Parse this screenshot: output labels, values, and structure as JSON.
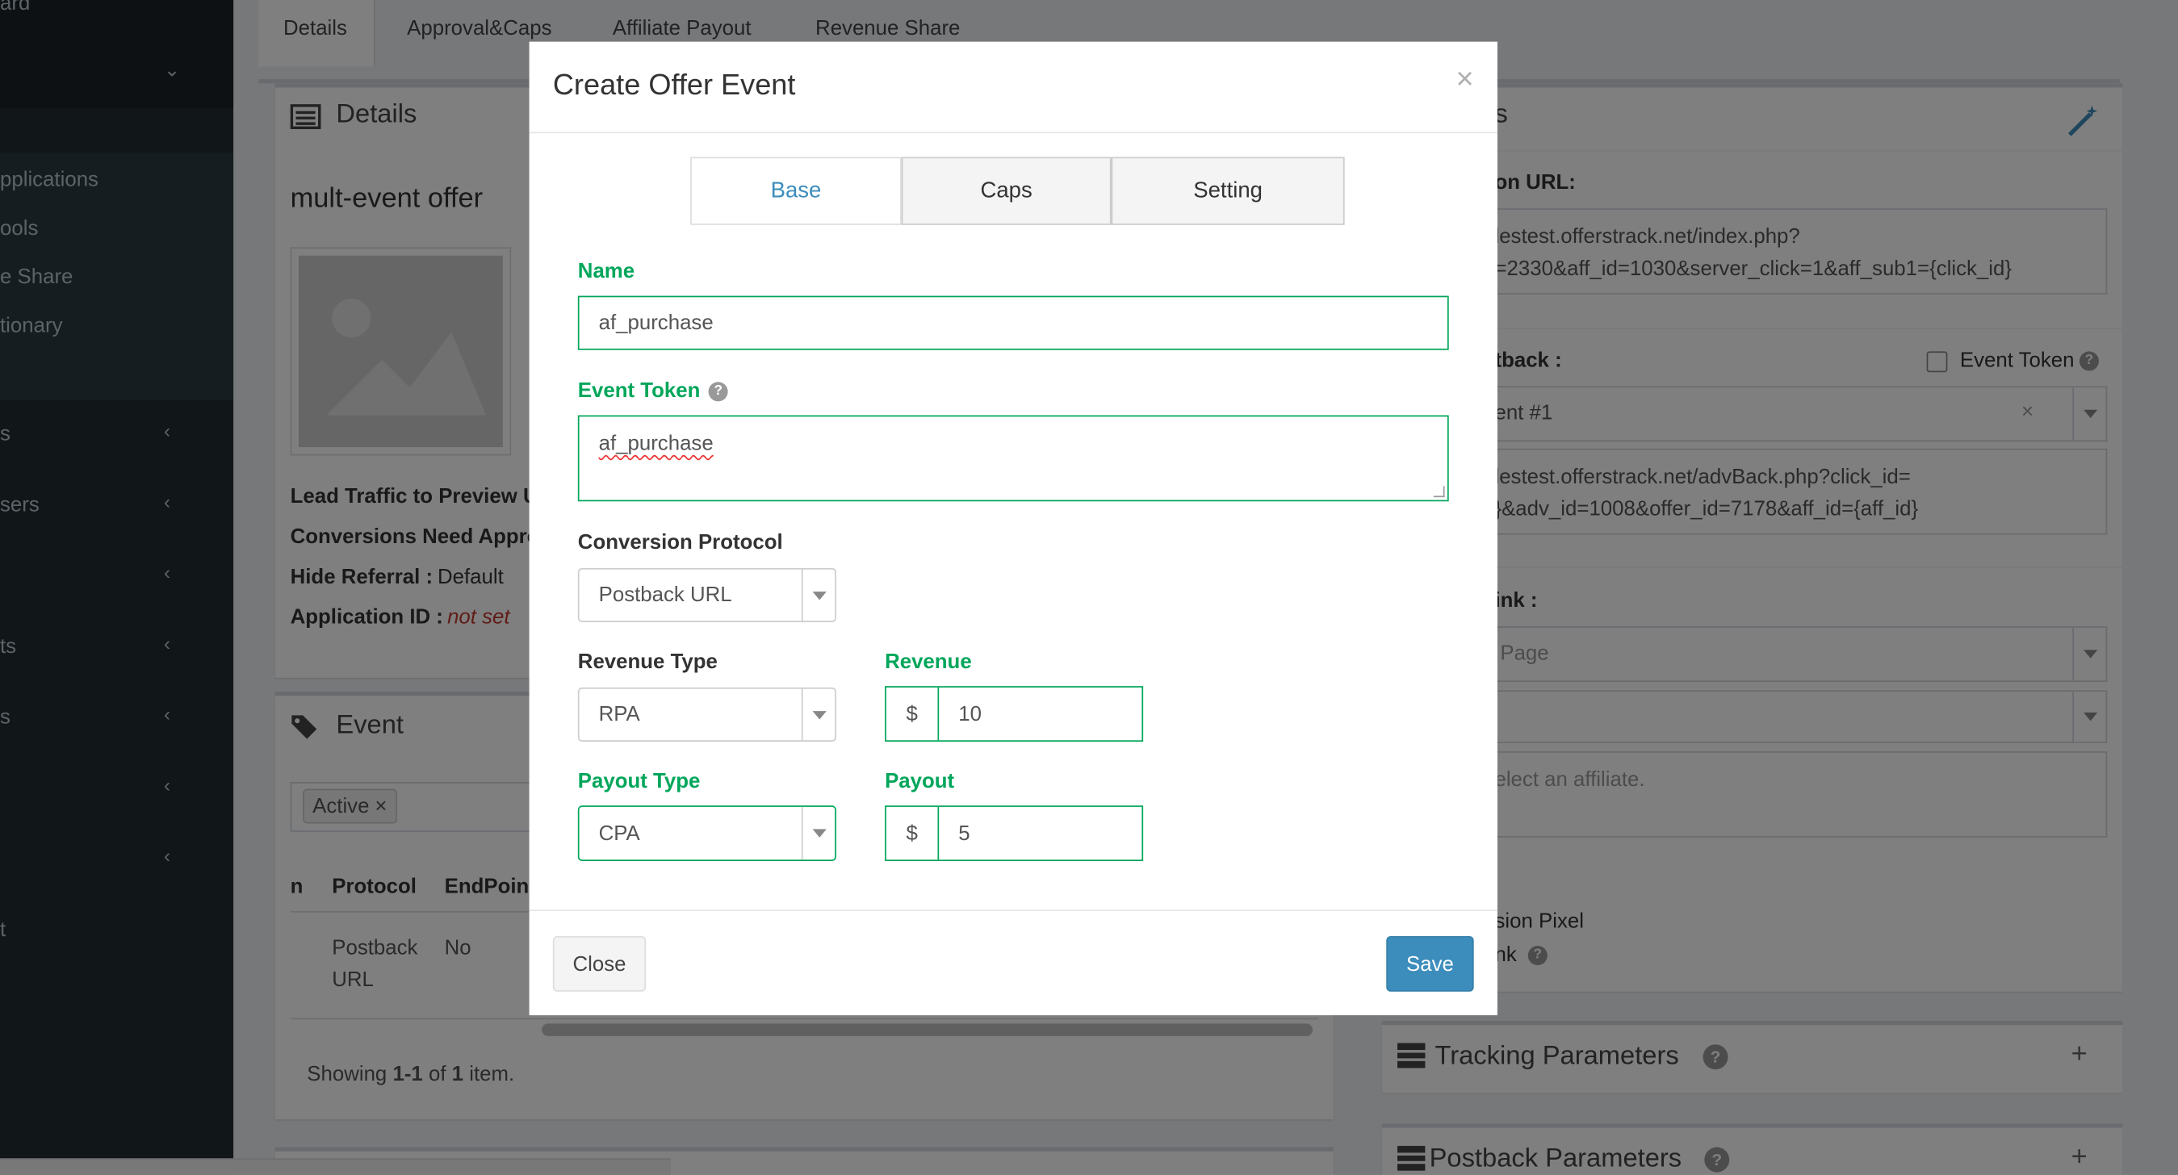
{
  "sidebar": {
    "items": [
      {
        "label": "ard"
      },
      {
        "label": "pplications"
      },
      {
        "label": "ools"
      },
      {
        "label": "e Share"
      },
      {
        "label": "tionary"
      },
      {
        "label": "s"
      },
      {
        "label": "sers"
      },
      {
        "label": "ts"
      },
      {
        "label": "s"
      },
      {
        "label": "t"
      }
    ]
  },
  "page_tabs": [
    "Details",
    "Approval&Caps",
    "Affiliate Payout",
    "Revenue Share"
  ],
  "details": {
    "title": "Details",
    "offer_name": "mult-event offer",
    "lead_traffic_label": "Lead Traffic to Preview U",
    "conversions_label": "Conversions Need Appro",
    "hide_referral_label": "Hide Referral :",
    "hide_referral_value": "Default",
    "application_id_label": "Application ID :",
    "application_id_value": "not set"
  },
  "event": {
    "title": "Event",
    "filter_chip": "Active",
    "columns": [
      "n",
      "Protocol",
      "EndPoin"
    ],
    "row": {
      "protocol_line1": "Postback",
      "protocol_line2": "URL",
      "endpoint": "No"
    },
    "summary_prefix": "Showing ",
    "summary_range": "1-1",
    "summary_mid": " of ",
    "summary_total": "1",
    "summary_suffix": " item."
  },
  "right_panel": {
    "title_fragment": "s",
    "conversion_url_label": "on URL:",
    "conversion_url_line1": "lestest.offerstrack.net/index.php?",
    "conversion_url_line2": "=2330&aff_id=1030&server_click=1&aff_sub1={click_id}",
    "postback_label": "tback :",
    "event_token_checkbox_label": "Event Token",
    "event_select_value": "ent #1",
    "postback_url_line1": "lestest.offerstrack.net/advBack.php?click_id=",
    "postback_url_line2": "}&adv_id=1008&offer_id=7178&aff_id={aff_id}",
    "link_label": "ink :",
    "link_select_value": "Page",
    "affiliate_placeholder": "elect an affiliate.",
    "pixel_label": "sion Pixel",
    "link2_label": "nk",
    "tracking_params_title": "Tracking Parameters",
    "postback_params_title": "Postback Parameters"
  },
  "modal": {
    "title": "Create Offer Event",
    "close_glyph": "×",
    "tabs": [
      "Base",
      "Caps",
      "Setting"
    ],
    "name_label": "Name",
    "name_value": "af_purchase",
    "event_token_label": "Event Token",
    "event_token_value": "af_purchase",
    "conversion_protocol_label": "Conversion Protocol",
    "conversion_protocol_value": "Postback URL",
    "revenue_type_label": "Revenue Type",
    "revenue_type_value": "RPA",
    "revenue_label": "Revenue",
    "revenue_currency": "$",
    "revenue_value": "10",
    "payout_type_label": "Payout Type",
    "payout_type_value": "CPA",
    "payout_label": "Payout",
    "payout_currency": "$",
    "payout_value": "5",
    "close_button": "Close",
    "save_button": "Save"
  },
  "colors": {
    "sidebar_bg": "#222d32",
    "accent_blue": "#3c8dbc",
    "success_green": "#00a65a"
  }
}
